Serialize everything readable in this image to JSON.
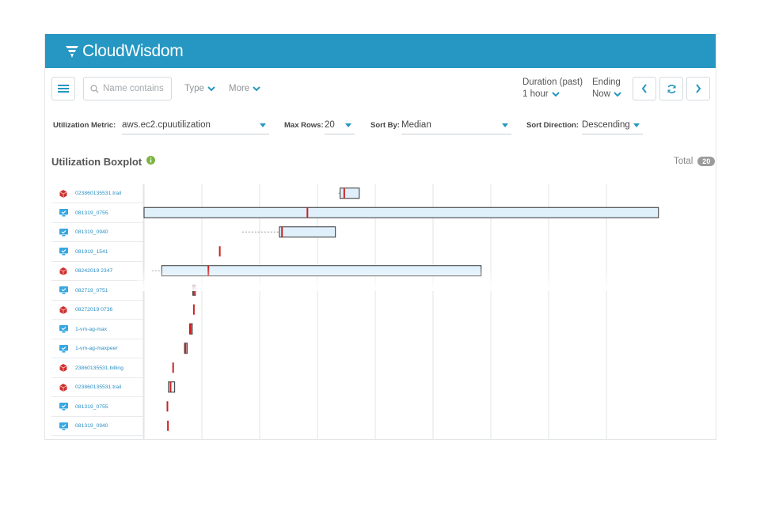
{
  "app": {
    "brand": "CloudWisdom",
    "brand_color": "#2597c2"
  },
  "toolbar": {
    "search_placeholder": "Name contains",
    "type_label": "Type",
    "more_label": "More",
    "duration_label": "Duration (past)",
    "duration_value": "1 hour",
    "ending_label": "Ending",
    "ending_value": "Now"
  },
  "filters": {
    "metric_label": "Utilization Metric:",
    "metric_value": "aws.ec2.cpuutilization",
    "maxrows_label": "Max Rows:",
    "maxrows_value": "20",
    "sortby_label": "Sort By:",
    "sortby_value": "Median",
    "sortdir_label": "Sort Direction:",
    "sortdir_value": "Descending"
  },
  "section": {
    "title": "Utilization Boxplot",
    "total_label": "Total",
    "total_value": "20"
  },
  "icons": {
    "aws": "aws-cube-icon",
    "vm": "monitor-icon"
  },
  "colors": {
    "box_fill": "#dff0fb",
    "box_stroke": "#333333",
    "median": "#cc2222",
    "link": "#2b8fc4",
    "aws": "#d0302f",
    "vm": "#37a7e0"
  },
  "chart_data": {
    "type": "boxplot",
    "orientation": "horizontal",
    "xlim": [
      0,
      100
    ],
    "grid": true,
    "rows": [
      {
        "name": "023860135531.trail",
        "kind": "aws",
        "whisker_lo": 37.5,
        "q1": 37.8,
        "median": 38.6,
        "q3": 41.5,
        "whisker_hi": 41.5
      },
      {
        "name": "081319_0755",
        "kind": "vm",
        "whisker_lo": 0.0,
        "q1": 0.0,
        "median": 31.5,
        "q3": 99.2,
        "whisker_hi": 99.2
      },
      {
        "name": "081319_0940",
        "kind": "vm",
        "whisker_lo": 18.9,
        "q1": 26.1,
        "median": 26.6,
        "q3": 36.9,
        "whisker_hi": 36.9
      },
      {
        "name": "081919_1541",
        "kind": "vm",
        "whisker_lo": 14.5,
        "q1": 14.5,
        "median": 14.6,
        "q3": 14.6,
        "whisker_hi": 14.6
      },
      {
        "name": "08242019 2347",
        "kind": "aws",
        "whisker_lo": 1.5,
        "q1": 3.4,
        "median": 12.4,
        "q3": 65.0,
        "whisker_hi": 65.0
      },
      {
        "name": "082719_0751",
        "kind": "vm",
        "whisker_lo": 9.4,
        "q1": 9.4,
        "median": 9.6,
        "q3": 9.9,
        "whisker_hi": 9.9
      },
      {
        "name": "08272019 0736",
        "kind": "aws",
        "whisker_lo": 9.5,
        "q1": 9.5,
        "median": 9.6,
        "q3": 9.6,
        "whisker_hi": 9.6
      },
      {
        "name": "1-vm-ag-max",
        "kind": "vm",
        "whisker_lo": 8.8,
        "q1": 8.8,
        "median": 9.0,
        "q3": 9.3,
        "whisker_hi": 9.3
      },
      {
        "name": "1-vm-ag-maxpeer",
        "kind": "vm",
        "whisker_lo": 7.8,
        "q1": 7.8,
        "median": 8.0,
        "q3": 8.3,
        "whisker_hi": 8.3
      },
      {
        "name": "23860135531.billing",
        "kind": "aws",
        "whisker_lo": 5.5,
        "q1": 5.5,
        "median": 5.6,
        "q3": 5.6,
        "whisker_hi": 5.6
      },
      {
        "name": "023860135531.trail",
        "kind": "aws",
        "whisker_lo": 4.7,
        "q1": 4.7,
        "median": 5.1,
        "q3": 5.9,
        "whisker_hi": 5.9
      },
      {
        "name": "081319_0755",
        "kind": "vm",
        "whisker_lo": 4.4,
        "q1": 4.4,
        "median": 4.5,
        "q3": 4.5,
        "whisker_hi": 4.5
      },
      {
        "name": "081319_0940",
        "kind": "vm",
        "whisker_lo": 4.5,
        "q1": 4.5,
        "median": 4.6,
        "q3": 4.6,
        "whisker_hi": 4.6
      }
    ]
  }
}
